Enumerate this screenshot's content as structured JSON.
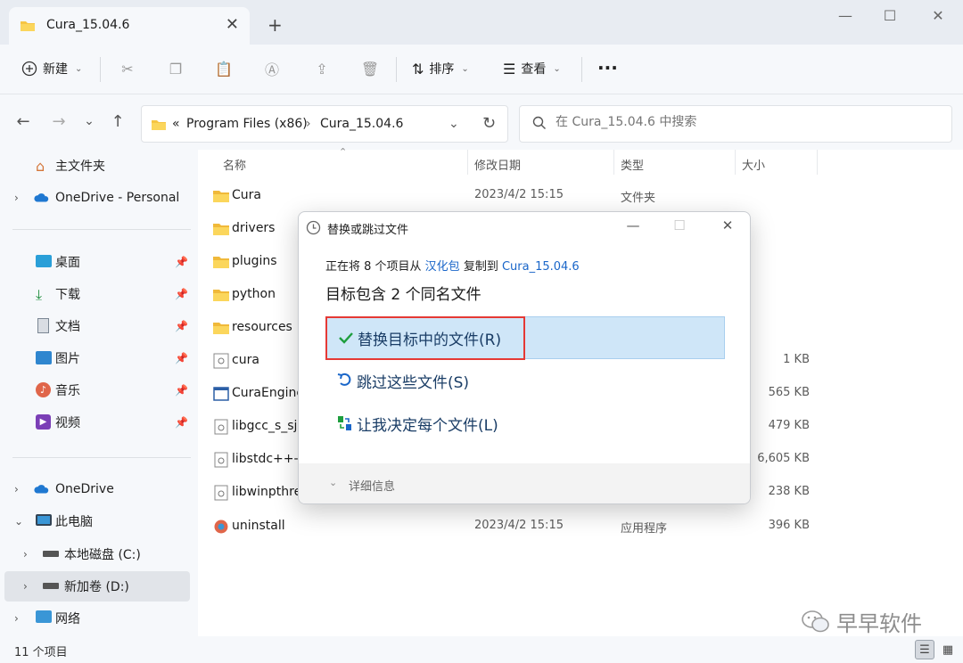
{
  "window": {
    "tab_title": "Cura_15.04.6",
    "tab_close": "✕",
    "new_tab": "+",
    "minimize": "—",
    "maximize": "☐",
    "close": "✕"
  },
  "toolbar": {
    "new_label": "新建",
    "sort_label": "排序",
    "view_label": "查看",
    "more": "···"
  },
  "address": {
    "overflow": "«",
    "crumbs": [
      "Program Files (x86)",
      "Cura_15.04.6"
    ],
    "separator": "›"
  },
  "search": {
    "placeholder": "在 Cura_15.04.6 中搜索"
  },
  "sidebar": {
    "items": [
      {
        "label": "主文件夹",
        "icon": "home-icon"
      },
      {
        "label": "OneDrive - Personal",
        "icon": "cloud-icon"
      },
      {
        "label": "桌面",
        "icon": "desktop-icon"
      },
      {
        "label": "下载",
        "icon": "download-icon"
      },
      {
        "label": "文档",
        "icon": "document-icon"
      },
      {
        "label": "图片",
        "icon": "picture-icon"
      },
      {
        "label": "音乐",
        "icon": "music-icon"
      },
      {
        "label": "视频",
        "icon": "video-icon"
      },
      {
        "label": "OneDrive",
        "icon": "cloud-icon"
      },
      {
        "label": "此电脑",
        "icon": "computer-icon"
      },
      {
        "label": "本地磁盘 (C:)",
        "icon": "drive-icon"
      },
      {
        "label": "新加卷 (D:)",
        "icon": "drive-icon"
      },
      {
        "label": "网络",
        "icon": "network-icon"
      }
    ]
  },
  "columns": {
    "name": "名称",
    "modified": "修改日期",
    "type": "类型",
    "size": "大小"
  },
  "files": [
    {
      "name": "Cura",
      "date": "2023/4/2 15:15",
      "type": "文件夹",
      "size": ""
    },
    {
      "name": "drivers",
      "date": "",
      "type": "",
      "size": ""
    },
    {
      "name": "plugins",
      "date": "",
      "type": "",
      "size": ""
    },
    {
      "name": "python",
      "date": "",
      "type": "",
      "size": ""
    },
    {
      "name": "resources",
      "date": "",
      "type": "",
      "size": ""
    },
    {
      "name": "cura",
      "date": "",
      "type": "",
      "size": "1 KB"
    },
    {
      "name": "CuraEngine",
      "date": "",
      "type": "",
      "size": "565 KB"
    },
    {
      "name": "libgcc_s_sjl",
      "date": "",
      "type": "",
      "size": "479 KB"
    },
    {
      "name": "libstdc++-6",
      "date": "",
      "type": "",
      "size": "6,605 KB"
    },
    {
      "name": "libwinpthre",
      "date": "",
      "type": "",
      "size": "238 KB"
    },
    {
      "name": "uninstall",
      "date": "2023/4/2 15:15",
      "type": "应用程序",
      "size": "396 KB"
    }
  ],
  "status": {
    "count": "11 个项目"
  },
  "watermark": {
    "text": "早早软件"
  },
  "dialog": {
    "title": "替换或跳过文件",
    "line_prefix": "正在将 8 个项目从 ",
    "source": "汉化包",
    "line_middle": " 复制到 ",
    "dest": "Cura_15.04.6",
    "heading": "目标包含 2 个同名文件",
    "options": [
      {
        "label": "替换目标中的文件(R)",
        "icon": "checkmark-icon"
      },
      {
        "label": "跳过这些文件(S)",
        "icon": "skip-icon"
      },
      {
        "label": "让我决定每个文件(L)",
        "icon": "decide-icon"
      }
    ],
    "details": "详细信息"
  },
  "colors": {
    "accent": "#1a66c9",
    "highlight": "#cfe6f8",
    "annotation": "#e53935",
    "folder": "#f6c544"
  }
}
